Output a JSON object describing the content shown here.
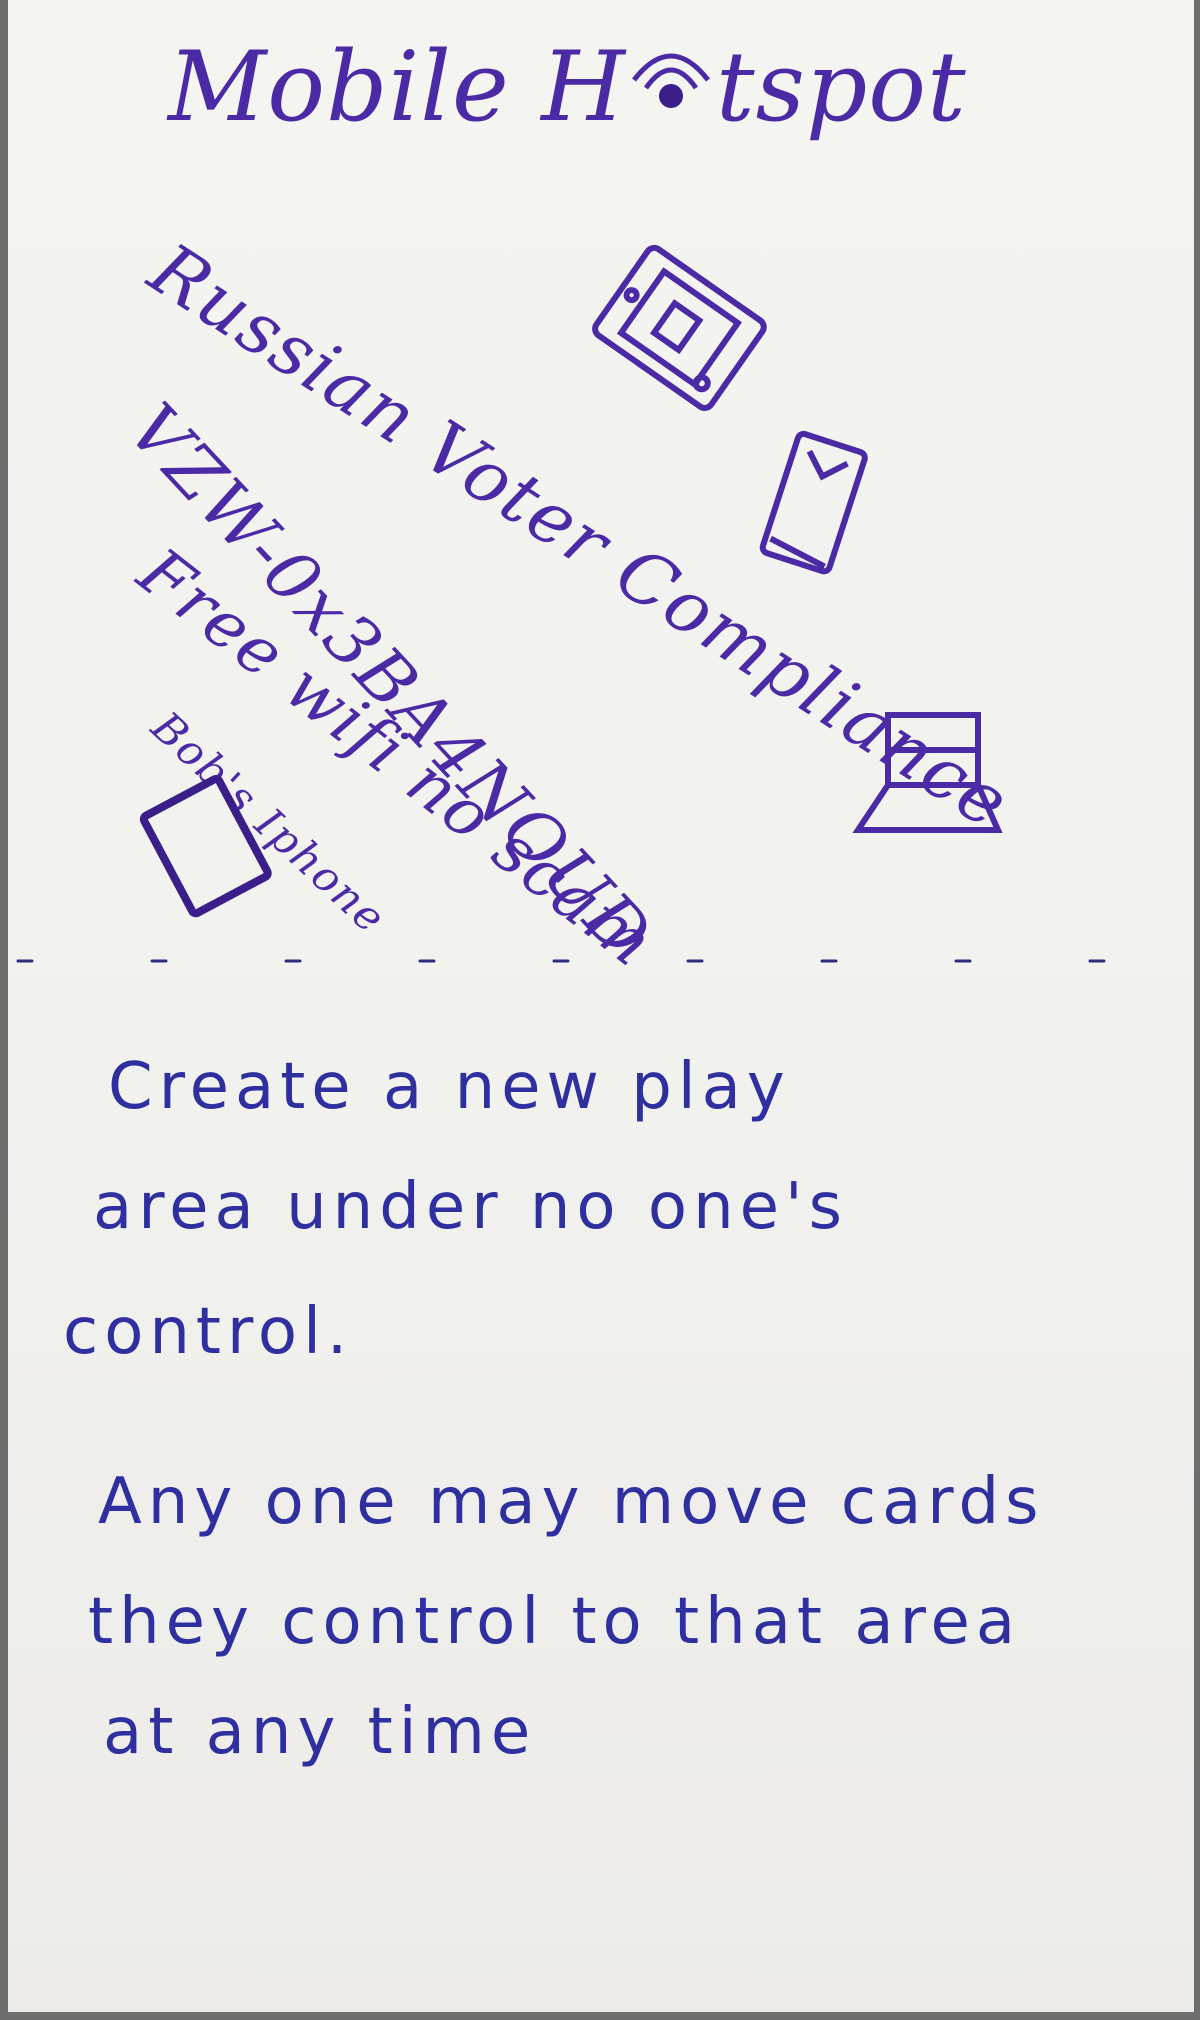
{
  "card": {
    "title": {
      "before": "Mobile H",
      "after": "tspot",
      "icon": "wifi-hotspot-icon"
    },
    "networks": [
      {
        "name": "Russian Voter Compliance",
        "icon": "tablet-icon"
      },
      {
        "name": "VZW-0x3BA4NOUD",
        "icon": "phone-icon"
      },
      {
        "name": "Free wifi no scam",
        "icon": "laptop-icon"
      },
      {
        "name": "Bob's Iphone",
        "icon": "phone-icon"
      }
    ],
    "rules_text": [
      "Create  a  new  play",
      "area  under  no  one's",
      "control.",
      "Any one  may move  cards",
      "they  control  to  that  area",
      "at  any  time"
    ]
  },
  "colors": {
    "ink_purple": "#4b2aa6",
    "ink_blue": "#2f2fa0",
    "paper": "#f2f2ef"
  }
}
